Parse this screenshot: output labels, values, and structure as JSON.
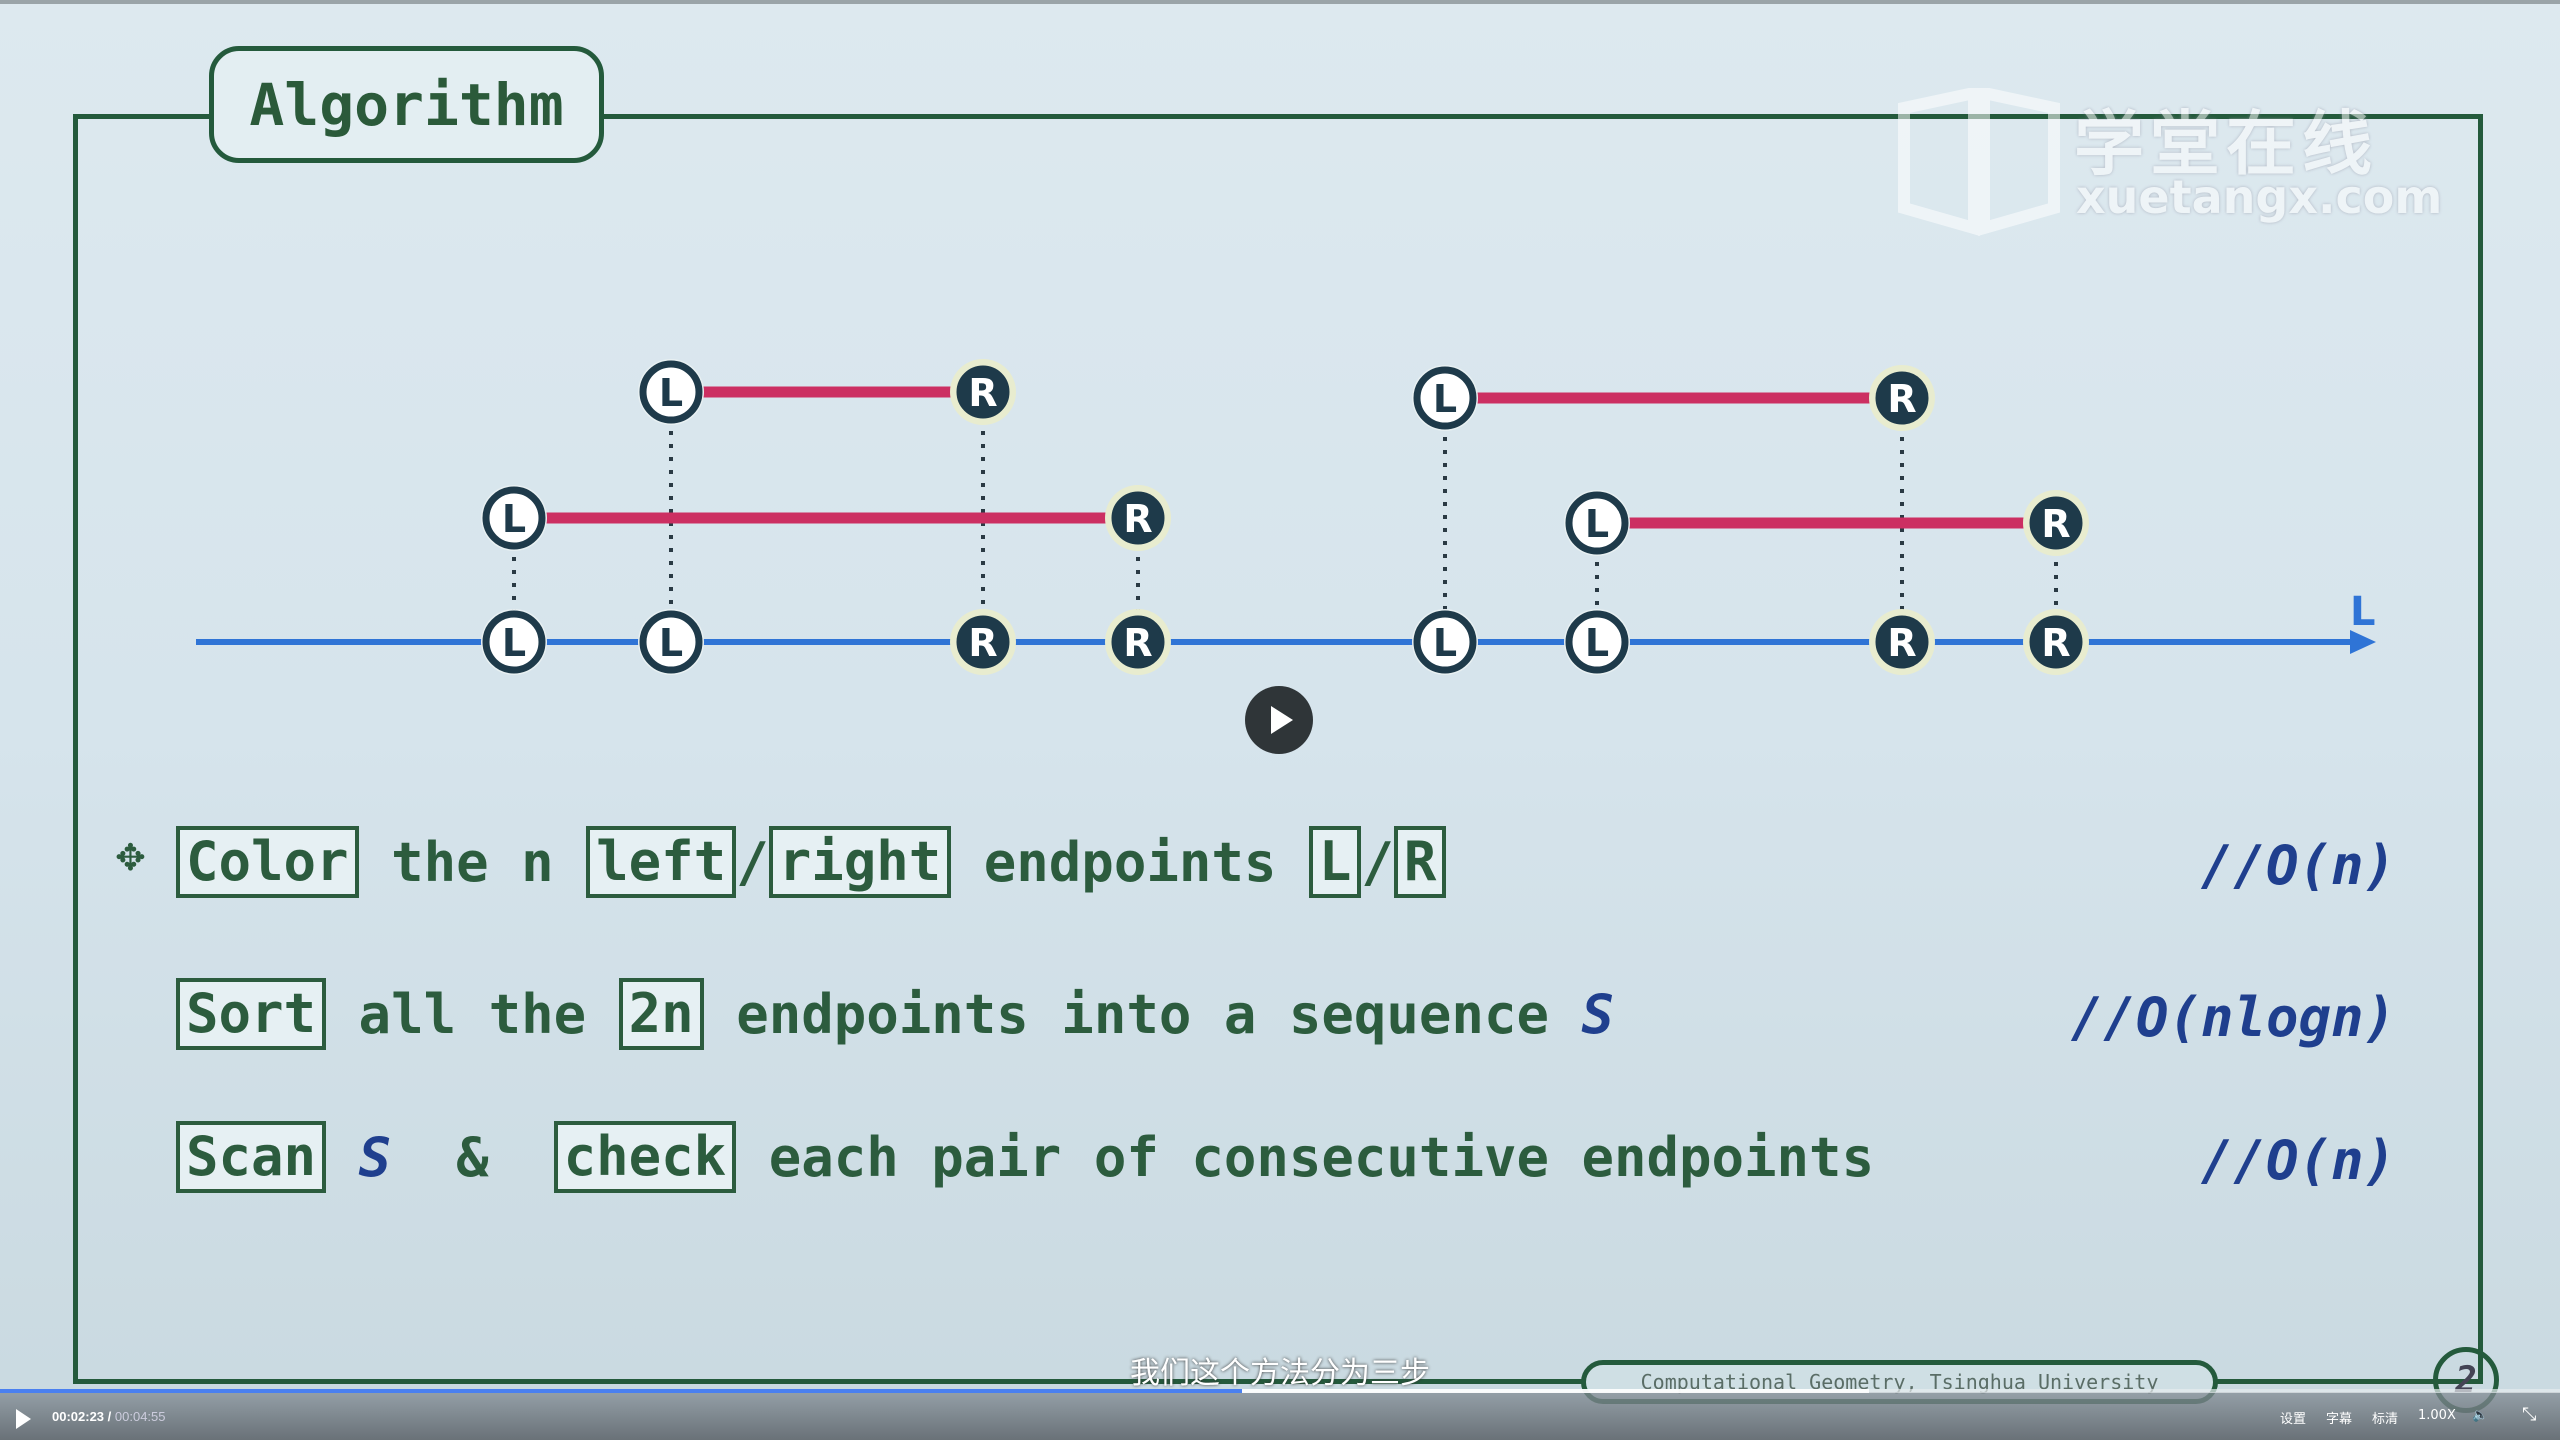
{
  "slide": {
    "title": "Algorithm",
    "watermark": {
      "line1": "学堂在线",
      "line2": "xuetangx.com"
    },
    "diagram": {
      "left_label": "L",
      "right_label": "R",
      "axis_label": "L"
    },
    "steps": [
      {
        "parts": [
          {
            "box": "Color"
          },
          {
            "text": " the n "
          },
          {
            "box": "left"
          },
          {
            "text": "/"
          },
          {
            "box": "right"
          },
          {
            "text": " endpoints "
          },
          {
            "box": "L"
          },
          {
            "text": "/"
          },
          {
            "box": "R"
          }
        ],
        "complexity": "//O(n)"
      },
      {
        "parts": [
          {
            "box": "Sort"
          },
          {
            "text": " all the "
          },
          {
            "box": "2n"
          },
          {
            "text": " endpoints into a sequence "
          },
          {
            "text": "S",
            "italic": true
          }
        ],
        "complexity": "//O(nlogn)"
      },
      {
        "parts": [
          {
            "box": "Scan"
          },
          {
            "text": " "
          },
          {
            "text": "S",
            "italic": true
          },
          {
            "text": "  &  "
          },
          {
            "box": "check"
          },
          {
            "text": " each pair of consecutive endpoints"
          }
        ],
        "complexity": "//O(n)"
      }
    ],
    "footer": "Computational Geometry, Tsinghua University",
    "page_number": "2"
  },
  "player": {
    "subtitle": "我们这个方法分为三步",
    "current_time": "00:02:23",
    "duration": "00:04:55",
    "progress": 0.485,
    "buffered": 0.73,
    "settings": "设置",
    "captions": "字幕",
    "quality": "标清",
    "speed": "1.00X",
    "volume_icon": "speaker-icon",
    "exit_fullscreen_icon": "exit-fullscreen-icon"
  },
  "colors": {
    "frame": "#245a3c",
    "segment": "#cc2f62",
    "axis": "#2f74d6",
    "progress": "#4a80f0"
  }
}
